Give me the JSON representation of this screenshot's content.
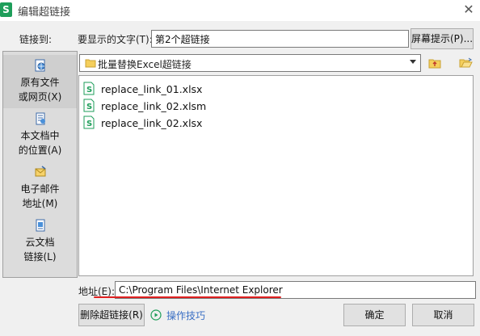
{
  "window": {
    "app_icon_letter": "S",
    "title": "编辑超链接",
    "close_glyph": "✕"
  },
  "link_to": {
    "label": "链接到:"
  },
  "display_text": {
    "label": "要显示的文字(T):",
    "value": "第2个超链接"
  },
  "screentip": {
    "label": "屏幕提示(P)..."
  },
  "sidebar": {
    "items": [
      {
        "line1": "原有文件",
        "line2": "或网页(X)",
        "icon": "web-page-icon",
        "selected": true
      },
      {
        "line1": "本文档中",
        "line2": "的位置(A)",
        "icon": "document-place-icon",
        "selected": false
      },
      {
        "line1": "电子邮件",
        "line2": "地址(M)",
        "icon": "email-icon",
        "selected": false
      },
      {
        "line1": "云文档",
        "line2": "链接(L)",
        "icon": "cloud-doc-icon",
        "selected": false
      }
    ]
  },
  "folder": {
    "name": "批量替换Excel超链接",
    "icon": "folder-icon"
  },
  "files": [
    {
      "name": "replace_link_01.xlsx",
      "icon": "spreadsheet-icon"
    },
    {
      "name": "replace_link_02.xlsm",
      "icon": "spreadsheet-icon"
    },
    {
      "name": "replace_link_02.xlsx",
      "icon": "spreadsheet-icon"
    }
  ],
  "address": {
    "label": "地址(E):",
    "value": "C:\\Program Files\\Internet Explorer"
  },
  "buttons": {
    "remove_link": "删除超链接(R)",
    "tips": "操作技巧",
    "ok": "确定",
    "cancel": "取消"
  },
  "colors": {
    "brand_green": "#1e9e5a",
    "link_blue": "#3a6fc4",
    "annotation_red": "#e02020"
  }
}
